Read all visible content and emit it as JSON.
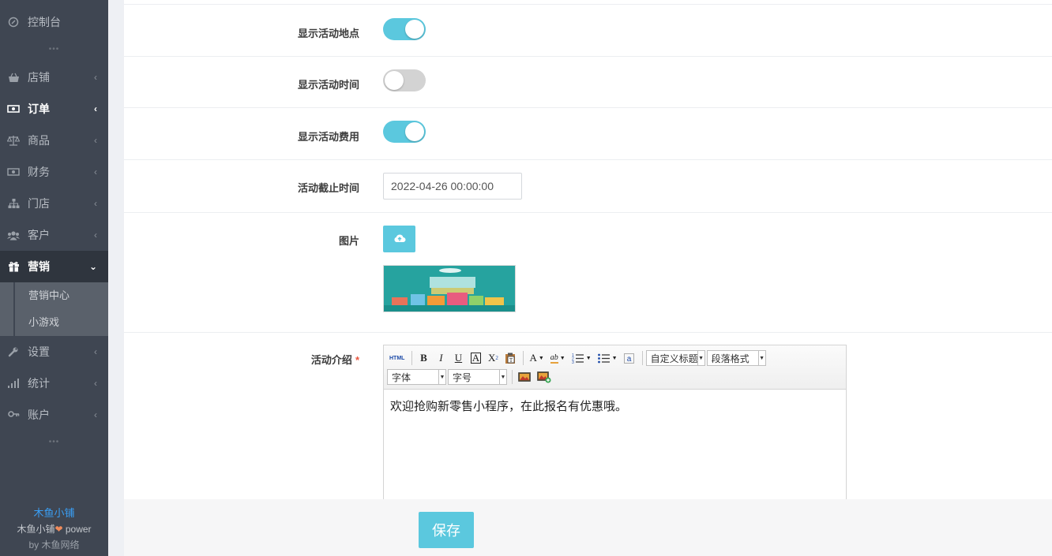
{
  "sidebar": {
    "items": [
      {
        "label": "控制台"
      },
      {
        "label": "店铺"
      },
      {
        "label": "订单"
      },
      {
        "label": "商品"
      },
      {
        "label": "财务"
      },
      {
        "label": "门店"
      },
      {
        "label": "客户"
      },
      {
        "label": "营销"
      },
      {
        "label": "设置"
      },
      {
        "label": "统计"
      },
      {
        "label": "账户"
      }
    ],
    "sub_items": [
      {
        "label": "营销中心"
      },
      {
        "label": "小游戏"
      }
    ],
    "footer": {
      "brand": "木鱼小铺",
      "line2_a": "木鱼小铺",
      "line2_b": "power",
      "line3": "by 木鱼网络"
    }
  },
  "form": {
    "show_location": {
      "label": "显示活动地点",
      "enabled": true
    },
    "show_time": {
      "label": "显示活动时间",
      "enabled": false
    },
    "show_fee": {
      "label": "显示活动费用",
      "enabled": true
    },
    "deadline": {
      "label": "活动截止时间",
      "value": "2022-04-26 00:00:00"
    },
    "image": {
      "label": "图片"
    },
    "intro": {
      "label": "活动介绍",
      "required_mark": "*",
      "toolbar": {
        "html": "HTML",
        "heading_select": "自定义标题",
        "paragraph_select": "段落格式",
        "font_select": "字体",
        "size_select": "字号"
      },
      "content": "欢迎抢购新零售小程序，在此报名有优惠哦。"
    }
  },
  "actions": {
    "save_label": "保存"
  }
}
